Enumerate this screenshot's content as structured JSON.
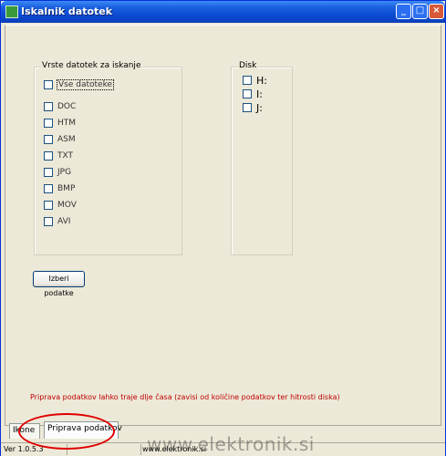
{
  "window": {
    "title": "Iskalnik datotek"
  },
  "titlebar_buttons": {
    "minimize": "_",
    "maximize": "□",
    "close": "×"
  },
  "files_group": {
    "legend": "Vrste datotek za iskanje",
    "items": [
      {
        "label": "Vse datoteke",
        "checked": false
      },
      {
        "label": "DOC",
        "checked": false
      },
      {
        "label": "HTM",
        "checked": false
      },
      {
        "label": "ASM",
        "checked": false
      },
      {
        "label": "TXT",
        "checked": false
      },
      {
        "label": "JPG",
        "checked": false
      },
      {
        "label": "BMP",
        "checked": false
      },
      {
        "label": "MOV",
        "checked": false
      },
      {
        "label": "AVI",
        "checked": false
      }
    ]
  },
  "disk_group": {
    "legend": "Disk",
    "items": [
      {
        "label": "H:",
        "checked": false
      },
      {
        "label": "I:",
        "checked": false
      },
      {
        "label": "J:",
        "checked": false
      }
    ]
  },
  "list_button": {
    "label": "Izberi podatke"
  },
  "warning_text": "Priprava podatkov lahko traje dlje časa (zavisi od količine podatkov ter hitrosti diska)",
  "tabs": [
    {
      "label": "Ikone"
    },
    {
      "label": "Priprava podatkov"
    }
  ],
  "status": {
    "version": "Ver 1.0.5.3",
    "url": "www.elektronik.si"
  },
  "watermark": "www.elektronik.si",
  "colors": {
    "title_bar": "#0a48d0",
    "warning": "#c00000",
    "annotation": "#e00000"
  }
}
